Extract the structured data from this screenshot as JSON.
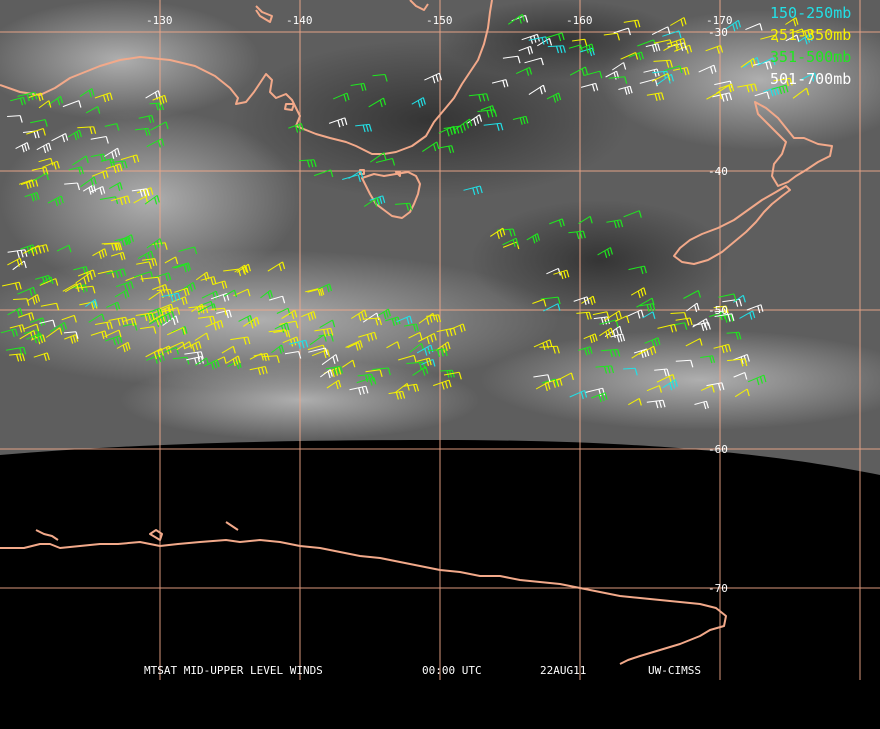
{
  "map": {
    "colors": {
      "background": "#000000",
      "coastline": "#f2a98a",
      "graticule": "#f2a98a",
      "high_level": "#22e0e6",
      "upper_level": "#f5f200",
      "mid_level": "#1fe81f",
      "lower_level": "#ffffff"
    },
    "longitude_labels": [
      "-130",
      "-140",
      "-150",
      "-160",
      "-170"
    ],
    "latitude_labels": [
      "-30",
      "-40",
      "-50",
      "-60",
      "-70"
    ]
  },
  "legend": [
    {
      "label": "150-250mb",
      "color": "#22e0e6"
    },
    {
      "label": "251-350mb",
      "color": "#f5f200"
    },
    {
      "label": "351-500mb",
      "color": "#1fe81f"
    },
    {
      "label": "501-700mb",
      "color": "#ffffff"
    }
  ],
  "footer": {
    "product": "MTSAT MID-UPPER LEVEL WINDS",
    "time": "00:00 UTC",
    "date": "22AUG11",
    "source": "UW-CIMSS"
  }
}
